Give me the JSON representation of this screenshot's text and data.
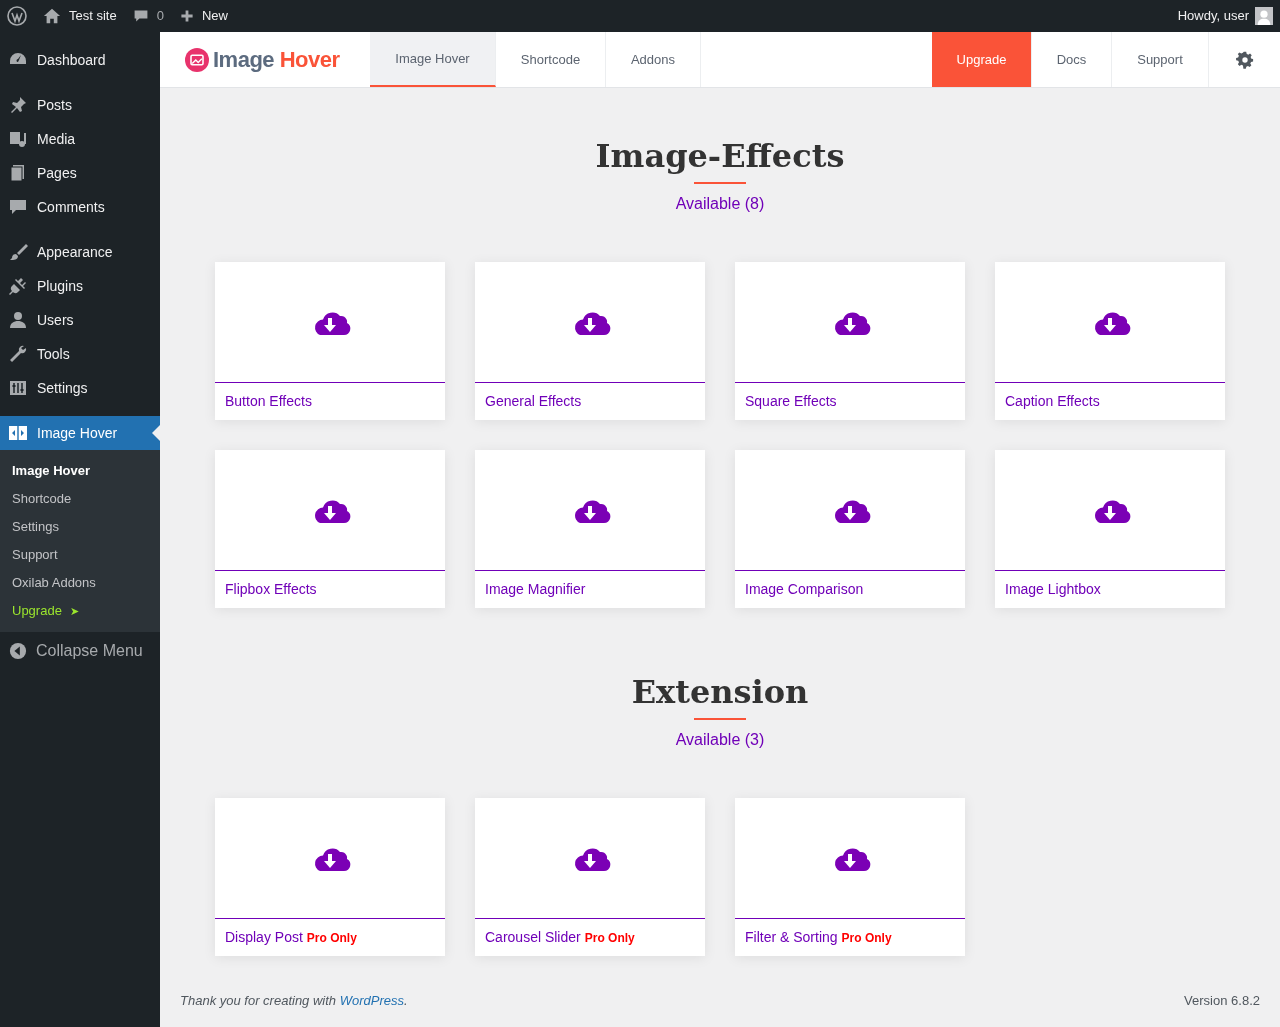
{
  "admin_bar": {
    "site": "Test site",
    "comments": "0",
    "new": "New",
    "greeting": "Howdy, user"
  },
  "sidebar": {
    "groups": [
      {
        "items": [
          {
            "label": "Dashboard",
            "selected": false
          }
        ]
      },
      {
        "items": [
          {
            "label": "Posts",
            "selected": false
          },
          {
            "label": "Media",
            "selected": false
          },
          {
            "label": "Pages",
            "selected": false
          },
          {
            "label": "Comments",
            "selected": false
          }
        ]
      },
      {
        "items": [
          {
            "label": "Appearance",
            "selected": false
          },
          {
            "label": "Plugins",
            "selected": false
          },
          {
            "label": "Users",
            "selected": false
          },
          {
            "label": "Tools",
            "selected": false
          },
          {
            "label": "Settings",
            "selected": false
          }
        ]
      },
      {
        "items": [
          {
            "label": "Image Hover",
            "selected": true
          }
        ]
      }
    ],
    "submenu": [
      {
        "label": "Image Hover",
        "selected": true,
        "kind": "normal"
      },
      {
        "label": "Shortcode",
        "selected": false,
        "kind": "normal"
      },
      {
        "label": "Settings",
        "selected": false,
        "kind": "normal"
      },
      {
        "label": "Support",
        "selected": false,
        "kind": "normal"
      },
      {
        "label": "Oxilab Addons",
        "selected": false,
        "kind": "normal"
      },
      {
        "label": "Upgrade",
        "selected": false,
        "kind": "upgrade",
        "arrow": "➤"
      }
    ],
    "collapse": "Collapse Menu"
  },
  "plugin_header": {
    "logo": {
      "word_1": "Image",
      "word_2": "Hover"
    },
    "tabs": [
      {
        "label": "Image Hover",
        "selected": true
      },
      {
        "label": "Shortcode",
        "selected": false
      },
      {
        "label": "Addons",
        "selected": false
      }
    ],
    "right_links": [
      {
        "label": "Upgrade",
        "kind": "highlight"
      },
      {
        "label": "Docs",
        "kind": "plain"
      },
      {
        "label": "Support",
        "kind": "plain"
      }
    ]
  },
  "sections": [
    {
      "title": "Image-Effects",
      "subtitle": "Available (8)",
      "cards": [
        {
          "title": "Button Effects"
        },
        {
          "title": "General Effects"
        },
        {
          "title": "Square Effects"
        },
        {
          "title": "Caption Effects"
        },
        {
          "title": "Flipbox Effects"
        },
        {
          "title": "Image Magnifier"
        },
        {
          "title": "Image Comparison"
        },
        {
          "title": "Image Lightbox"
        }
      ]
    },
    {
      "title": "Extension",
      "subtitle": "Available (3)",
      "cards": [
        {
          "title": "Display Post",
          "badge": "Pro Only"
        },
        {
          "title": "Carousel Slider",
          "badge": "Pro Only"
        },
        {
          "title": "Filter & Sorting",
          "badge": "Pro Only"
        }
      ]
    }
  ],
  "footer": {
    "text": "Thank you for creating with ",
    "link": "WordPress",
    "end": ".",
    "version": "Version 6.8.2"
  }
}
